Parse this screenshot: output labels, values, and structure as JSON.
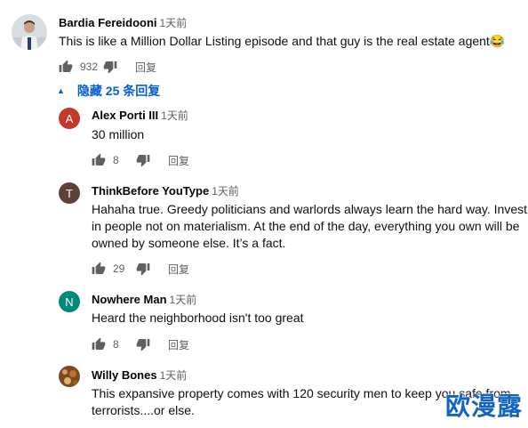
{
  "top_comment": {
    "author": "Bardia Fereidooni",
    "time": "1天前",
    "text": "This is like a Million Dollar Listing episode and that guy is the real estate agent😂",
    "likes": "932",
    "reply_label": "回复"
  },
  "hide_replies": {
    "label": "隐藏 25 条回复"
  },
  "replies": [
    {
      "initial": "A",
      "avatar_color": "#c53929",
      "author": "Alex Porti III",
      "time": "1天前",
      "lines": [
        "30 million"
      ],
      "likes": "8",
      "reply_label": "回复"
    },
    {
      "initial": "T",
      "avatar_color": "#5d4037",
      "author": "ThinkBefore YouType",
      "time": "1天前",
      "lines": [
        "Hahaha true. Greedy politicians and warlords always learn the hard way. Invest",
        "in people not on materialism. At the end of the day, everything you own will be",
        "owned by someone else. It’s a fact."
      ],
      "likes": "29",
      "reply_label": "回复"
    },
    {
      "initial": "N",
      "avatar_color": "#00897b",
      "author": "Nowhere Man",
      "time": "1天前",
      "lines": [
        "Heard the neighborhood isn't too great"
      ],
      "likes": "8",
      "reply_label": "回复"
    },
    {
      "initial": "",
      "avatar_color": "#8d5a2b",
      "author": "Willy Bones",
      "time": "1天前",
      "lines": [
        "This expansive property comes with 120 security men to keep you safe from",
        "terrorists....or else."
      ]
    }
  ],
  "watermark": "欧漫露"
}
